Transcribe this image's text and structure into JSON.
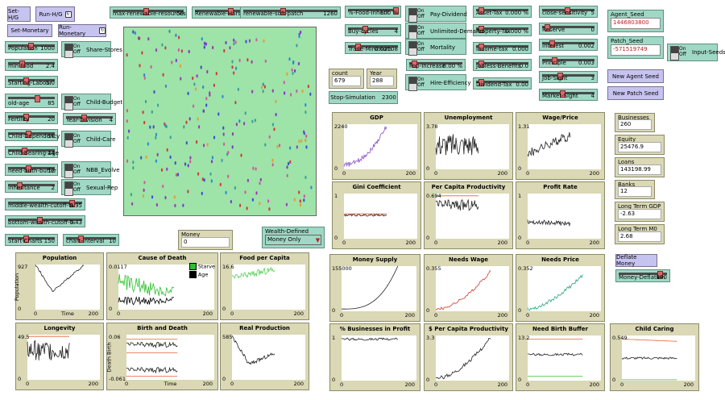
{
  "buttons": {
    "set_hg": "Set-H/G",
    "run_hg": "Run-H/G",
    "set_monetary": "Set-Monetary",
    "run_monetary": "Run-Monetary",
    "stop_simulation": "Stop-Simulation",
    "new_agent_seed": "New Agent Seed",
    "new_patch_seed": "New Patch Seed",
    "deflate_money": "Deflate Money"
  },
  "sliders": [
    {
      "id": "max-renewable-resources",
      "label": "max-renewable-resources",
      "value": "50",
      "frac": 0.45
    },
    {
      "id": "renewable-harshness",
      "label": "Renewable-Harshness",
      "value": "35",
      "frac": 0.55
    },
    {
      "id": "renewable-soft-patch",
      "label": "renewable-soft-patch",
      "value": "1260",
      "frac": 0.4
    },
    {
      "id": "pct-food-inherit",
      "label": "%-Food-Inherit",
      "value": "100 %",
      "frac": 0.95
    },
    {
      "id": "buy-cycles",
      "label": "Buy-cycles",
      "value": "4",
      "frac": 0.3
    },
    {
      "id": "trade-minimum",
      "label": "Trade-Minimum",
      "value": "0.00108",
      "frac": 0.15
    },
    {
      "id": "pop-increase",
      "label": "Pop-Increase",
      "value": "0.00 %",
      "frac": 0.05
    },
    {
      "id": "asset-tax",
      "label": "Asset-Tax",
      "value": "0.000 %",
      "frac": 0.05
    },
    {
      "id": "property-tax",
      "label": "Property-Tax",
      "value": "0.000 %",
      "frac": 0.05
    },
    {
      "id": "income-tax",
      "label": "Income-tax",
      "value": "0.000",
      "frac": 0.05
    },
    {
      "id": "jobless-benefits",
      "label": "Jobless-Benefits",
      "value": "0.0",
      "frac": 0.05
    },
    {
      "id": "dividend-tax",
      "label": "Dividend-Tax",
      "value": "0.00",
      "frac": 0.05
    },
    {
      "id": "close-sensitivity",
      "label": "close-sensitivity",
      "value": "5",
      "frac": 0.45
    },
    {
      "id": "reserve",
      "label": "Reserve",
      "value": "0",
      "frac": 0.05
    },
    {
      "id": "interest",
      "label": "Interest",
      "value": "0.002",
      "frac": 0.15
    },
    {
      "id": "principle",
      "label": "Principle",
      "value": "0.003",
      "frac": 0.2
    },
    {
      "id": "job-sight",
      "label": "Job-Sight",
      "value": "3",
      "frac": 0.3
    },
    {
      "id": "market-sight",
      "label": "Market-Sight",
      "value": "4",
      "frac": 0.35
    },
    {
      "id": "population",
      "label": "Population",
      "value": "1000",
      "frac": 0.45
    },
    {
      "id": "min-food",
      "label": "min-food",
      "value": "2.4",
      "frac": 0.25
    },
    {
      "id": "starting-labour",
      "label": "Starting-Labour",
      "value": "5.0",
      "frac": 0.35
    },
    {
      "id": "old-age",
      "label": "old-age",
      "value": "85",
      "frac": 0.6
    },
    {
      "id": "fertility",
      "label": "Fertility",
      "value": "20",
      "frac": 0.35
    },
    {
      "id": "child-dependency",
      "label": "Child-Dependency",
      "value": "16",
      "frac": 0.4
    },
    {
      "id": "child-bearing-age",
      "label": "Child-Bearing-Age",
      "value": "14",
      "frac": 0.3
    },
    {
      "id": "need-birth-buffer",
      "label": "need-birth-buffer",
      "value": "12",
      "frac": 0.4
    },
    {
      "id": "inheritance",
      "label": "Inheritance",
      "value": "2",
      "frac": 0.2
    },
    {
      "id": "year-division",
      "label": "Year-Division",
      "value": "4",
      "frac": 0.35
    },
    {
      "id": "middle-wealth-cutoff",
      "label": "middle-wealth-cutoff-%",
      "value": "0.95",
      "frac": 0.85
    },
    {
      "id": "bottom-wealth-cutoff",
      "label": "bottom-wealth-cutoff-%",
      "value": "0.43",
      "frac": 0.4
    },
    {
      "id": "start-charts",
      "label": "Start-Charts",
      "value": "150",
      "frac": 0.35
    },
    {
      "id": "chart-interval",
      "label": "chart-interval",
      "value": "10",
      "frac": 0.25
    },
    {
      "id": "money-deflation",
      "label": "Money-Deflation",
      "value": "100",
      "frac": 0.85
    }
  ],
  "switches": {
    "on": "On",
    "off": "Off",
    "share_stores": "Share-Stores",
    "child_budget": "Child-Budget",
    "child_care": "Child-Care",
    "nbb_evolve": "NBB_Evolve",
    "sexual_rep": "Sexual-Rep",
    "pay_dividend": "Pay-Dividend",
    "unlimited_demand": "Unlimited-Demand",
    "mortality": "Mortality",
    "hire_efficiency": "Hire-Efficiency",
    "input_seeds": "Input-Seeds"
  },
  "monitors": {
    "count_turtles": {
      "label": "count turtles",
      "value": "679"
    },
    "year": {
      "label": "Year",
      "value": "288"
    },
    "money": {
      "label": "Money",
      "value": "0"
    },
    "businesses": {
      "label": "Businesses",
      "value": "260"
    },
    "equity": {
      "label": "Equity",
      "value": "25476.9"
    },
    "loans": {
      "label": "Loans",
      "value": "143198.99"
    },
    "banks": {
      "label": "Banks",
      "value": "12"
    },
    "long_term_gdp": {
      "label": "Long Term GDP",
      "value": "-2.63"
    },
    "long_term_m0": {
      "label": "Long Term M0",
      "value": "2.68"
    }
  },
  "inputs": {
    "agent_seed": {
      "label": "Agent_Seed",
      "value": "1446803800"
    },
    "patch_seed": {
      "label": "Patch_Seed",
      "value": "-571519749"
    }
  },
  "chooser": {
    "label": "Wealth-Defined",
    "value": "Money Only",
    "arrow": "▼"
  },
  "plots": {
    "gdp": {
      "title": "GDP",
      "ymax": "2240",
      "ymin": "0",
      "xmin": "0",
      "xmax": "200"
    },
    "unemployment": {
      "title": "Unemployment",
      "ymax": "3.78",
      "ymin": "0",
      "xmin": "0",
      "xmax": "200"
    },
    "wage_price": {
      "title": "Wage/Price",
      "ymax": "1.31",
      "ymin": "0",
      "xmin": "0",
      "xmax": "200"
    },
    "gini": {
      "title": "Gini Coefficient",
      "ymax": "1",
      "ymin": "0",
      "xmin": "0",
      "xmax": "200"
    },
    "per_capita_prod": {
      "title": "Per Capita Productivity",
      "ymax": "0.694",
      "ymin": "0",
      "xmin": "0",
      "xmax": "200"
    },
    "profit_rate": {
      "title": "Profit Rate",
      "ymax": "1",
      "ymin": "0",
      "xmin": "0",
      "xmax": "200"
    },
    "population": {
      "title": "Population",
      "ymax": "927",
      "ymin": "0",
      "xmin": "0",
      "xmax": "200",
      "xlabel": "Time",
      "ylabel": "Population"
    },
    "cause_of_death": {
      "title": "Cause of Death",
      "ymax": "0.0117",
      "ymin": "0",
      "xmin": "0",
      "xmax": "200",
      "legend": [
        "Starve",
        "Age"
      ]
    },
    "food_per_capita": {
      "title": "Food per Capita",
      "ymax": "16.6",
      "ymin": "0",
      "xmin": "0",
      "xmax": "200"
    },
    "longevity": {
      "title": "Longevity",
      "ymax": "49.5",
      "ymin": "0",
      "xmin": "0",
      "xmax": "200"
    },
    "birth_and_death": {
      "title": "Birth and Death",
      "ymax": "0.06",
      "ymin": "-0.061",
      "xmin": "0",
      "xmax": "200",
      "xlabel": "Time",
      "ylabel": "Death  Birth"
    },
    "real_production": {
      "title": "Real Production",
      "ymax": "585",
      "ymin": "0",
      "xmin": "0",
      "xmax": "200"
    },
    "money_supply": {
      "title": "Money Supply",
      "ymax": "155000",
      "ymin": "0",
      "xmin": "0",
      "xmax": "200"
    },
    "needs_wage": {
      "title": "Needs Wage",
      "ymax": "0.355",
      "ymin": "0",
      "xmin": "0",
      "xmax": "200"
    },
    "needs_price": {
      "title": "Needs Price",
      "ymax": "0.352",
      "ymin": "0",
      "xmin": "0",
      "xmax": "200"
    },
    "businesses_profit": {
      "title": "% Businesses in Profit",
      "ymax": "1",
      "ymin": "0",
      "xmin": "0",
      "xmax": "200"
    },
    "dollar_per_capita": {
      "title": "$ Per Capita Productivity",
      "ymax": "3.3",
      "ymin": "0",
      "xmin": "0",
      "xmax": "200"
    },
    "need_birth_buffer": {
      "title": "Need Birth Buffer",
      "ymax": "13.2",
      "ymin": "0",
      "xmin": "0",
      "xmax": "200"
    },
    "child_caring": {
      "title": "Child Caring",
      "ymax": "0.549",
      "ymin": "0",
      "xmin": "0",
      "xmax": "200"
    }
  },
  "colors": {
    "gdp_line": "#8a4fc7",
    "money_line": "#222222",
    "needs_wage_line": "#d03a2a",
    "needs_price_line": "#2aa57a",
    "starve_line": "#2fbf2f",
    "age_line": "#000000",
    "food_line": "#5fcf5f",
    "orange_line": "#e8603a",
    "green_line": "#3fbf3f"
  }
}
